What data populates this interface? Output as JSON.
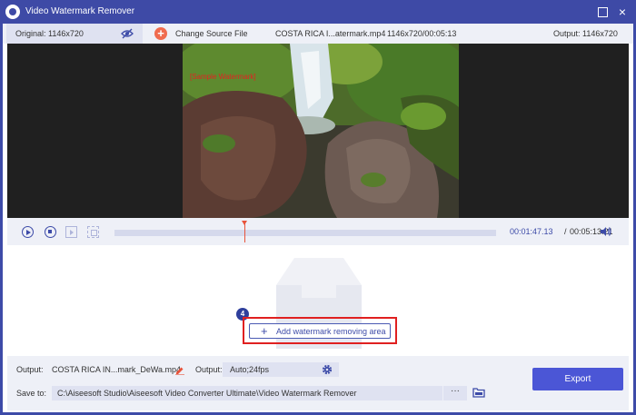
{
  "window": {
    "title": "Video Watermark Remover",
    "close_glyph": "×"
  },
  "infobar": {
    "original_label": "Original: 1146x720",
    "add_glyph": "+",
    "change_source": "Change Source File",
    "file_name": "COSTA RICA I...atermark.mp4",
    "file_meta": "1146x720/00:05:13",
    "output_label": "Output: 1146x720"
  },
  "preview": {
    "sample_watermark": "[Sample Watermark]"
  },
  "player": {
    "current_time": "00:01:47.13",
    "separator": "/",
    "total_time": "00:05:13.21",
    "progress_fraction": 0.34
  },
  "workspace": {
    "step_badge": "4",
    "add_glyph": "+",
    "add_area_label": "Add watermark removing area"
  },
  "bottom": {
    "output_label": "Output:",
    "output_file": "COSTA RICA IN...mark_DeWa.mp4",
    "format_label": "Output:",
    "format_value": "Auto;24fps",
    "save_label": "Save to:",
    "save_path": "C:\\Aiseesoft Studio\\Aiseesoft Video Converter Ultimate\\Video Watermark Remover",
    "browse_label": "···",
    "export_label": "Export"
  },
  "colors": {
    "accent": "#3d4ba8",
    "export": "#4b56d6",
    "highlight": "#e02020",
    "playhead": "#e8533a"
  }
}
